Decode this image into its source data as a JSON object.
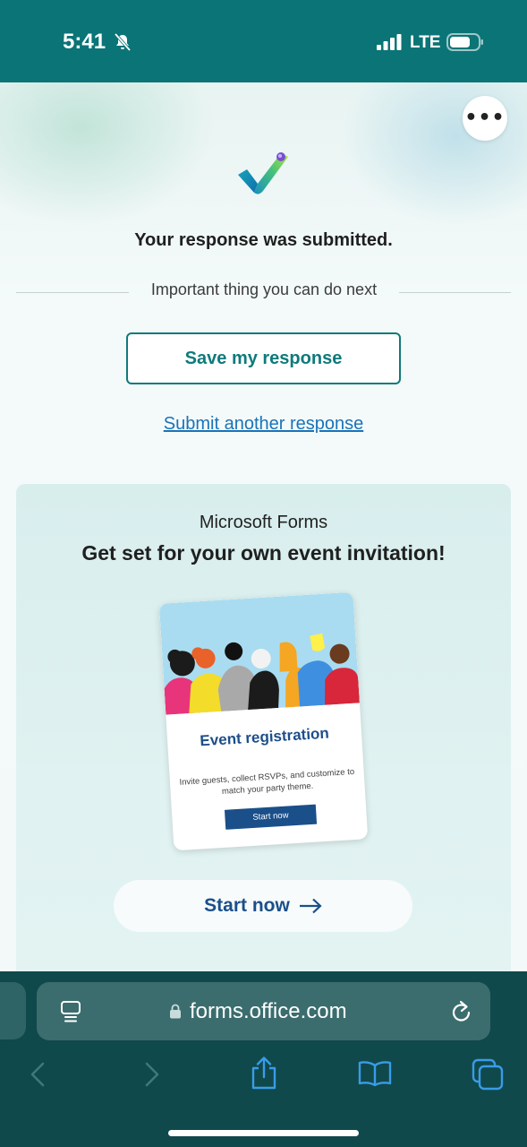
{
  "status_bar": {
    "time": "5:41",
    "carrier": "LTE",
    "icons": [
      "bell-slash-icon",
      "signal-icon",
      "battery-icon"
    ]
  },
  "confirmation": {
    "title": "Your response was submitted.",
    "next_label": "Important thing you can do next",
    "save_button": "Save my response",
    "submit_another_link": "Submit another response"
  },
  "promo": {
    "brand": "Microsoft Forms",
    "heading": "Get set for your own event invitation!",
    "card": {
      "title": "Event registration",
      "description": "Invite guests, collect RSVPs, and customize to match your party theme.",
      "button": "Start now"
    },
    "start_button": "Start now"
  },
  "browser": {
    "url": "forms.office.com",
    "icons": [
      "reader-icon",
      "lock-icon",
      "reload-icon",
      "back-icon",
      "forward-icon",
      "share-icon",
      "bookmarks-icon",
      "tabs-icon"
    ]
  },
  "colors": {
    "status_bar": "#0b7476",
    "accent_teal": "#0f7a7b",
    "link_blue": "#1a73b8",
    "brand_navy": "#1a4f8a",
    "browser_bar": "#10494b"
  }
}
